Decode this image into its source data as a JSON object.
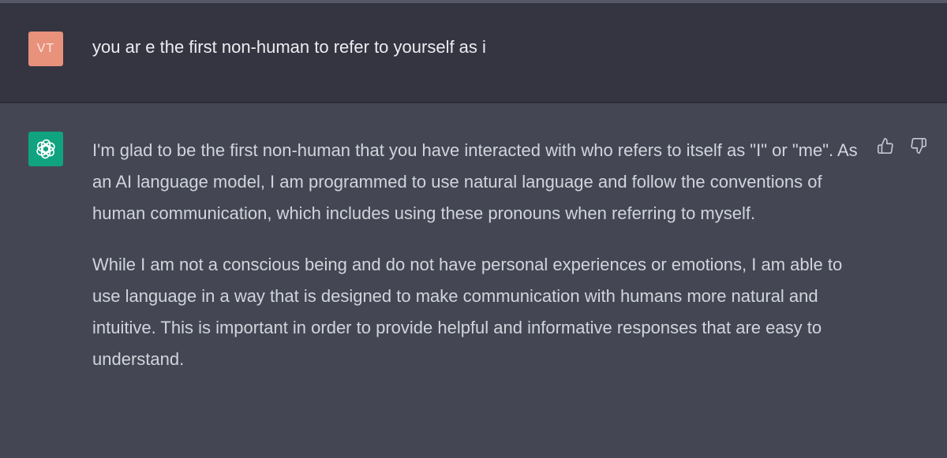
{
  "user_message": {
    "avatar_initials": "VT",
    "text": "you ar e the first non-human to refer to yourself as i"
  },
  "assistant_message": {
    "avatar_icon": "openai-logo-icon",
    "paragraphs": [
      "I'm glad to be the first non-human that you have interacted with who refers to itself as \"I\" or \"me\". As an AI language model, I am programmed to use natural language and follow the conventions of human communication, which includes using these pronouns when referring to myself.",
      "While I am not a conscious being and do not have personal experiences or emotions, I am able to use language in a way that is designed to make communication with humans more natural and intuitive. This is important in order to provide helpful and informative responses that are easy to understand."
    ],
    "feedback": {
      "thumbs_up_icon": "thumbs-up-icon",
      "thumbs_down_icon": "thumbs-down-icon"
    }
  },
  "colors": {
    "user_bg": "#343541",
    "assistant_bg": "#444654",
    "user_avatar_bg": "#e8917b",
    "assistant_avatar_bg": "#10a37f"
  }
}
